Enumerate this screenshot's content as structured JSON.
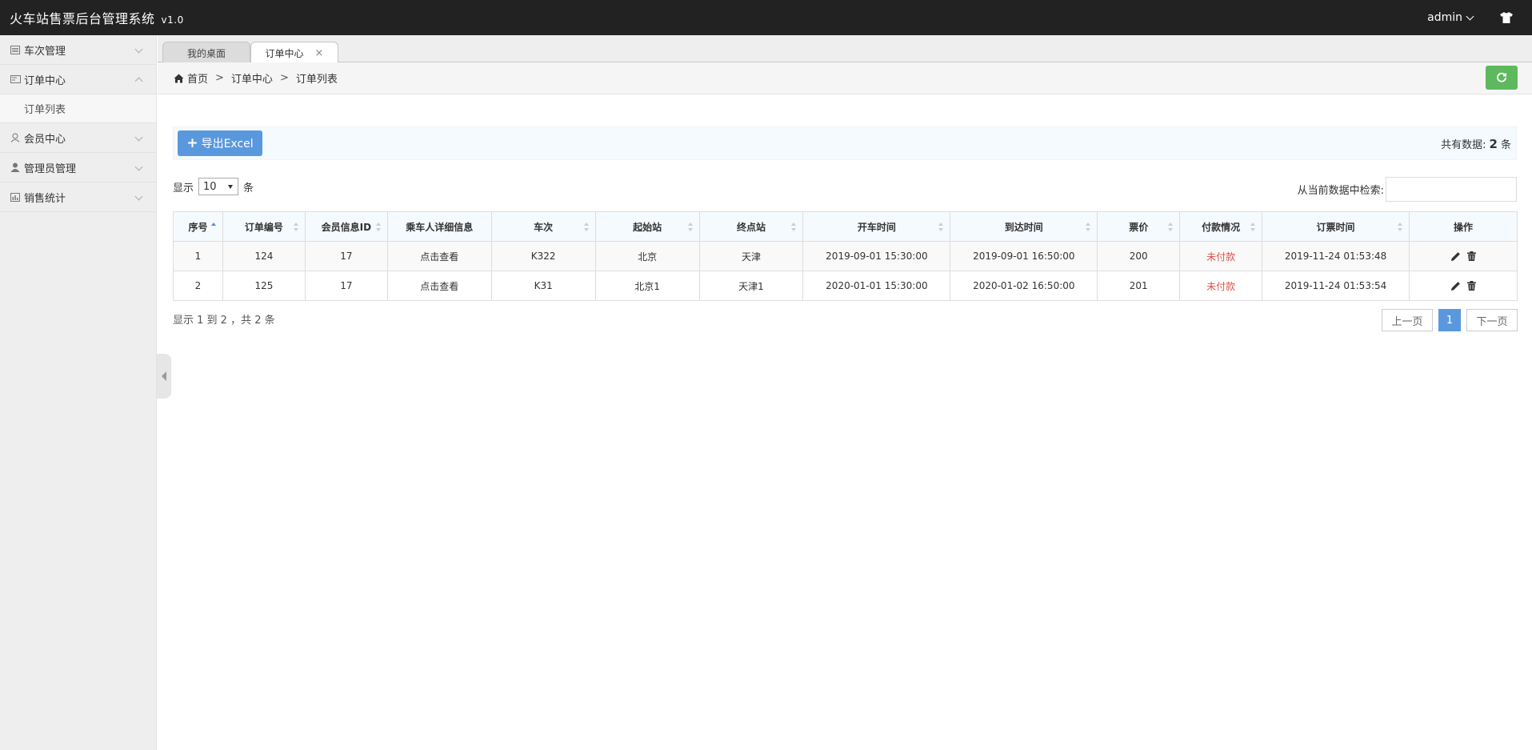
{
  "header": {
    "title": "火车站售票后台管理系统",
    "version": "v1.0",
    "user": "admin",
    "skin_icon": "shirt-icon"
  },
  "sidebar": {
    "items": [
      {
        "label": "车次管理",
        "icon": "train-list-icon"
      },
      {
        "label": "订单中心",
        "icon": "order-card-icon",
        "expanded": true,
        "children": [
          {
            "label": "订单列表"
          }
        ]
      },
      {
        "label": "会员中心",
        "icon": "member-icon"
      },
      {
        "label": "管理员管理",
        "icon": "admin-user-icon"
      },
      {
        "label": "销售统计",
        "icon": "stats-icon"
      }
    ]
  },
  "tabs": [
    {
      "label": "我的桌面"
    },
    {
      "label": "订单中心",
      "close": "×",
      "active": true
    }
  ],
  "breadcrumb": {
    "home": "首页",
    "sep": ">",
    "level1": "订单中心",
    "level2": "订单列表"
  },
  "toolbar": {
    "export_label": "导出Excel",
    "count_prefix": "共有数据:",
    "count": "2",
    "count_suffix": "条"
  },
  "length": {
    "prefix": "显示",
    "value": "10",
    "suffix": "条"
  },
  "search": {
    "label": "从当前数据中检索:",
    "value": ""
  },
  "table": {
    "headers": [
      "序号",
      "订单编号",
      "会员信息ID",
      "乘车人详细信息",
      "车次",
      "起始站",
      "终点站",
      "开车时间",
      "到达时间",
      "票价",
      "付款情况",
      "订票时间",
      "操作"
    ],
    "rows": [
      {
        "no": "1",
        "order_id": "124",
        "member_id": "17",
        "passenger": "点击查看",
        "train": "K322",
        "from": "北京",
        "to": "天津",
        "depart": "2019-09-01 15:30:00",
        "arrive": "2019-09-01 16:50:00",
        "price": "200",
        "pay": "未付款",
        "booked": "2019-11-24 01:53:48"
      },
      {
        "no": "2",
        "order_id": "125",
        "member_id": "17",
        "passenger": "点击查看",
        "train": "K31",
        "from": "北京1",
        "to": "天津1",
        "depart": "2020-01-01 15:30:00",
        "arrive": "2020-01-02 16:50:00",
        "price": "201",
        "pay": "未付款",
        "booked": "2019-11-24 01:53:54"
      }
    ]
  },
  "footer": {
    "info": "显示 1 到 2 ，共 2 条",
    "prev": "上一页",
    "current_page": "1",
    "next": "下一页"
  },
  "colors": {
    "header_bg": "#222222",
    "primary": "#5a98de",
    "success": "#5eb95e",
    "danger": "#dd514c"
  }
}
